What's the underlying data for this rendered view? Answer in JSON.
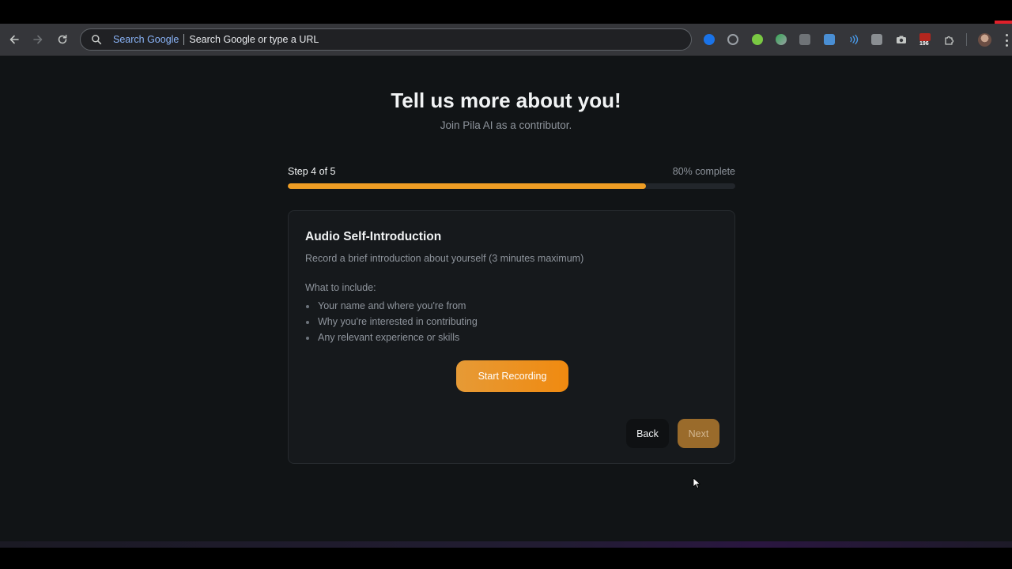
{
  "browser": {
    "omnibox": {
      "engine_label": "Search Google",
      "placeholder": "Search Google or type a URL"
    },
    "extensions_badge": "196",
    "icons": [
      "back-arrow-icon",
      "forward-arrow-icon",
      "reload-icon",
      "search-icon",
      "puzzle-icon",
      "avatar",
      "more-vert-icon"
    ]
  },
  "page": {
    "title": "Tell us more about you!",
    "subtitle": "Join Pila AI as a contributor."
  },
  "progress": {
    "step_label": "Step 4 of 5",
    "percent_label": "80% complete",
    "fraction": 0.8,
    "color": "#ee9d24"
  },
  "card": {
    "title": "Audio Self-Introduction",
    "description": "Record a brief introduction about yourself (3 minutes maximum)",
    "include_heading": "What to include:",
    "include_items": [
      "Your name and where you're from",
      "Why you're interested in contributing",
      "Any relevant experience or skills"
    ],
    "record_button": "Start Recording",
    "back_button": "Back",
    "next_button": "Next"
  },
  "colors": {
    "accent": "#f08a10",
    "background": "#111416",
    "card": "#16191c"
  }
}
